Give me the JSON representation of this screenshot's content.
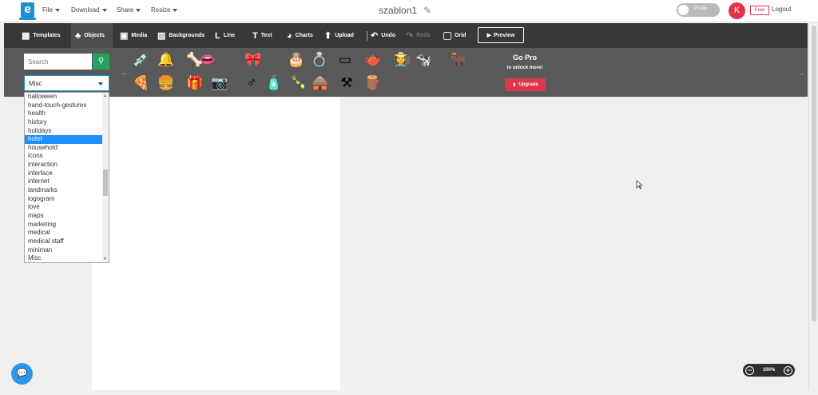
{
  "topbar": {
    "logo_letter": "e",
    "menus": [
      "File",
      "Download",
      "Share",
      "Resize"
    ],
    "document_title": "szablon1",
    "visibility_toggle": "Public",
    "avatar_initial": "K",
    "plan_badge": "Free",
    "logout": "Logout"
  },
  "toolbar": {
    "templates": "Templates",
    "objects": "Objects",
    "media": "Media",
    "backgrounds": "Backgrounds",
    "line": "Line",
    "text": "Text",
    "charts": "Charts",
    "upload": "Upload",
    "undo": "Undo",
    "redo": "Redo",
    "grid": "Grid",
    "preview": "Preview"
  },
  "objects_panel": {
    "search_placeholder": "Search",
    "category_selected": "Misc",
    "gopro_title": "Go Pro",
    "gopro_subtitle": "to unlock more!",
    "upgrade_label": "Upgrade",
    "objects": [
      {
        "icon": "syringe-icon",
        "glyph": "💉"
      },
      {
        "icon": "bell-flower-icon",
        "glyph": "🔔"
      },
      {
        "icon": "bone-icon",
        "glyph": "🦴"
      },
      {
        "icon": "lips-icon",
        "glyph": "👄"
      },
      {
        "icon": "ribbon-banner-icon",
        "glyph": "🎀"
      },
      {
        "icon": "cake-icon",
        "glyph": "🎂"
      },
      {
        "icon": "ring-icon",
        "glyph": "💍"
      },
      {
        "icon": "frame-icon",
        "glyph": "▭"
      },
      {
        "icon": "teapot-icon",
        "glyph": "🫖"
      },
      {
        "icon": "farmer-icon",
        "glyph": "🧑‍🌾"
      },
      {
        "icon": "cow-icon",
        "glyph": "🐄"
      },
      {
        "icon": "ox-icon",
        "glyph": "🐂"
      },
      {
        "icon": "pizza-icon",
        "glyph": "🍕"
      },
      {
        "icon": "burger-icon",
        "glyph": "🍔"
      },
      {
        "icon": "gift-icon",
        "glyph": "🎁"
      },
      {
        "icon": "camera-icon",
        "glyph": "📷"
      },
      {
        "icon": "male-symbol-icon",
        "glyph": "♂"
      },
      {
        "icon": "perfume-icon",
        "glyph": "🧴"
      },
      {
        "icon": "bottle-icon",
        "glyph": "🍾"
      },
      {
        "icon": "barn-icon",
        "glyph": "🛖"
      },
      {
        "icon": "crossed-tools-icon",
        "glyph": "⚒"
      },
      {
        "icon": "fence-icon",
        "glyph": "🪵"
      }
    ]
  },
  "category_dropdown": {
    "items": [
      "halloween",
      "hand-touch-gestures",
      "health",
      "history",
      "holidays",
      "hotel",
      "household",
      "icons",
      "interaction",
      "interface",
      "internet",
      "landmarks",
      "logogram",
      "love",
      "maps",
      "marketing",
      "medical",
      "medical staff",
      "miniman",
      "Misc"
    ],
    "highlighted": "hotel"
  },
  "zoom": {
    "level": "100%"
  },
  "colors": {
    "toolbar_bg": "#383838",
    "panel_bg": "#595959",
    "accent_green": "#27a25f",
    "accent_red": "#e0344c",
    "highlight_blue": "#1e90ff"
  }
}
